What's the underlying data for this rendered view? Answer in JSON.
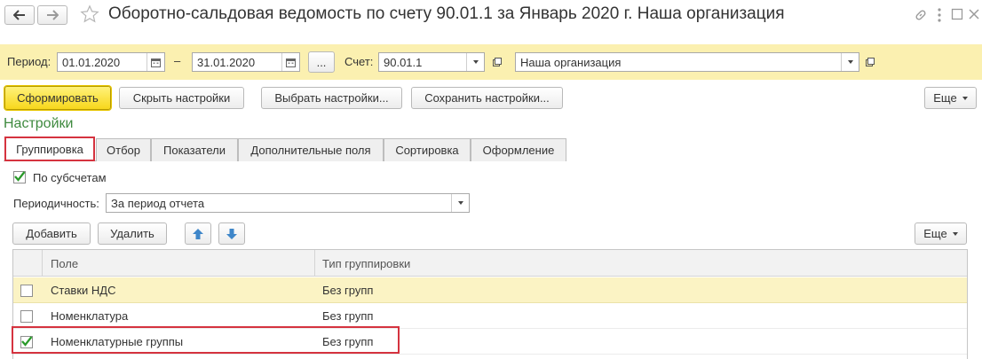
{
  "window": {
    "title": "Оборотно-сальдовая ведомость по счету 90.01.1 за Январь 2020 г. Наша организация"
  },
  "params": {
    "period_label": "Период:",
    "date_from": "01.01.2020",
    "dash": "–",
    "date_to": "31.01.2020",
    "ellipsis": "...",
    "account_label": "Счет:",
    "account_value": "90.01.1",
    "org_value": "Наша организация"
  },
  "toolbar": {
    "generate": "Сформировать",
    "hide_settings": "Скрыть настройки",
    "choose_settings": "Выбрать настройки...",
    "save_settings": "Сохранить настройки...",
    "more": "Еще"
  },
  "settings": {
    "title": "Настройки",
    "tabs": [
      "Группировка",
      "Отбор",
      "Показатели",
      "Дополнительные поля",
      "Сортировка",
      "Оформление"
    ],
    "by_subaccounts": "По субсчетам",
    "periodicity_label": "Периодичность:",
    "periodicity_value": "За период отчета",
    "add": "Добавить",
    "delete": "Удалить",
    "more": "Еще"
  },
  "table": {
    "columns": [
      "Поле",
      "Тип группировки"
    ],
    "rows": [
      {
        "field": "Ставки НДС",
        "type": "Без групп",
        "checked": false
      },
      {
        "field": "Номенклатура",
        "type": "Без групп",
        "checked": false
      },
      {
        "field": "Номенклатурные группы",
        "type": "Без групп",
        "checked": true
      }
    ]
  },
  "colors": {
    "yellow_band": "#fbf0b0",
    "primary_button": "#ffe23a",
    "green_title": "#3f8a3f",
    "highlight_red": "#d5333f",
    "selected_row": "#fbf3c4",
    "arrow_blue": "#3e86c9"
  },
  "icons": [
    "back-arrow-icon",
    "forward-arrow-icon",
    "favorite-star-icon",
    "link-icon",
    "kebab-menu-icon",
    "maximize-icon",
    "close-icon",
    "calendar-icon",
    "dropdown-arrow-icon",
    "open-icon",
    "move-up-icon",
    "move-down-icon",
    "checkmark-icon"
  ]
}
